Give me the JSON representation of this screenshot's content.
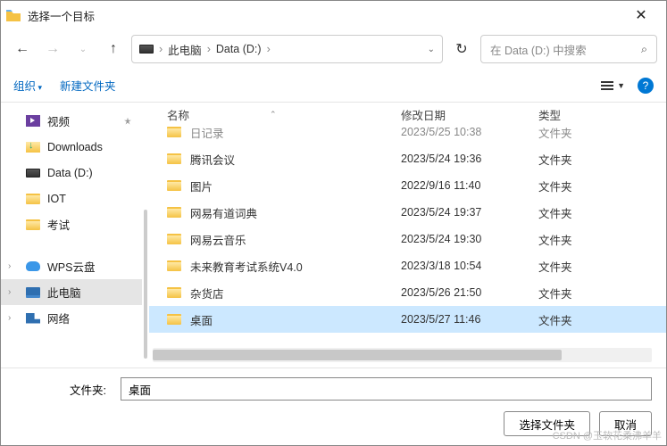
{
  "title": "选择一个目标",
  "breadcrumb": {
    "pc": "此电脑",
    "drive": "Data (D:)"
  },
  "search": {
    "placeholder": "在 Data (D:) 中搜索"
  },
  "toolbar": {
    "organize": "组织",
    "newfolder": "新建文件夹"
  },
  "sidebar": {
    "quick": [
      {
        "label": "视频",
        "icon": "video",
        "pin": true
      },
      {
        "label": "Downloads",
        "icon": "down"
      },
      {
        "label": "Data (D:)",
        "icon": "drive"
      },
      {
        "label": "IOT",
        "icon": "folder"
      },
      {
        "label": "考试",
        "icon": "folder"
      }
    ],
    "tree": [
      {
        "label": "WPS云盘",
        "icon": "cloud"
      },
      {
        "label": "此电脑",
        "icon": "pc",
        "sel": true
      },
      {
        "label": "网络",
        "icon": "net"
      }
    ]
  },
  "columns": {
    "name": "名称",
    "date": "修改日期",
    "type": "类型"
  },
  "files": [
    {
      "name": "日记录",
      "date": "2023/5/25 10:38",
      "type": "文件夹",
      "cut": true
    },
    {
      "name": "腾讯会议",
      "date": "2023/5/24 19:36",
      "type": "文件夹"
    },
    {
      "name": "图片",
      "date": "2022/9/16 11:40",
      "type": "文件夹"
    },
    {
      "name": "网易有道词典",
      "date": "2023/5/24 19:37",
      "type": "文件夹"
    },
    {
      "name": "网易云音乐",
      "date": "2023/5/24 19:30",
      "type": "文件夹"
    },
    {
      "name": "未来教育考试系统V4.0",
      "date": "2023/3/18 10:54",
      "type": "文件夹"
    },
    {
      "name": "杂货店",
      "date": "2023/5/26 21:50",
      "type": "文件夹"
    },
    {
      "name": "桌面",
      "date": "2023/5/27 11:46",
      "type": "文件夹",
      "sel": true
    }
  ],
  "footer": {
    "label": "文件夹:",
    "value": "桌面",
    "select": "选择文件夹",
    "cancel": "取消"
  },
  "watermark": "CSDN @玉软花柔沸羊羊"
}
